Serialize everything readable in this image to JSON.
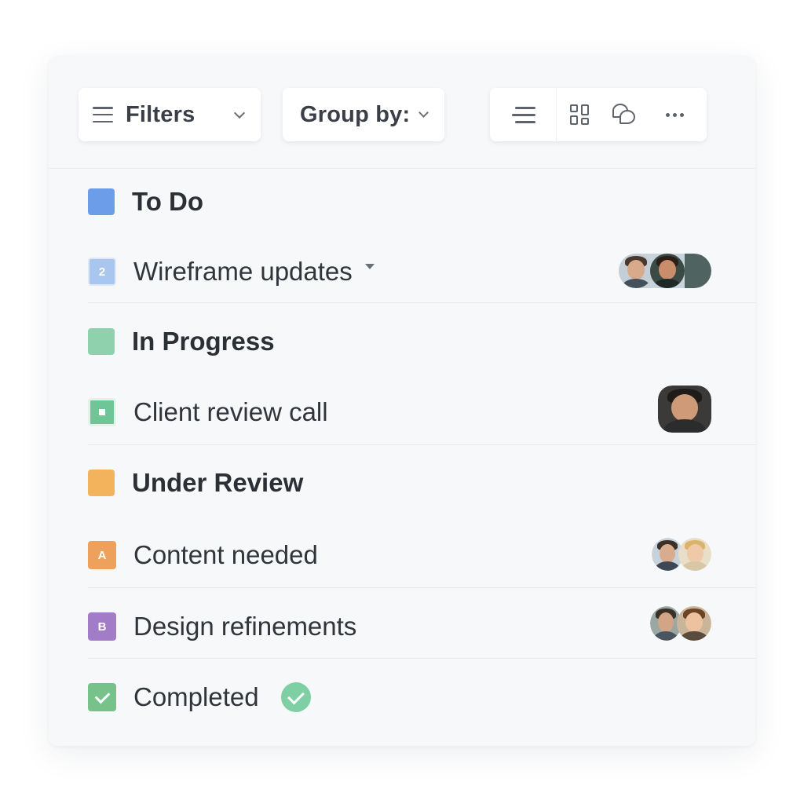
{
  "toolbar": {
    "filters_label": "Filters",
    "groupby_label": "Group by:",
    "views": [
      "list-view-icon",
      "board-view-icon",
      "chat-view-icon",
      "more-icon"
    ]
  },
  "groups": {
    "todo": {
      "title": "To Do",
      "color": "#6b9de8",
      "tasks": [
        {
          "title": "Wireframe updates",
          "badge": "2",
          "badge_color": "#a9c6ee",
          "assignees": 2
        }
      ]
    },
    "in_progress": {
      "title": "In Progress",
      "color": "#8fd1ac",
      "tasks": [
        {
          "title": "Client review call",
          "badge": "▪",
          "badge_color": "#6ec596",
          "assignees": 1
        }
      ]
    },
    "under_review": {
      "title": "Under Review",
      "color": "#f3b25c",
      "tasks": [
        {
          "title": "Content needed",
          "badge": "A",
          "badge_color": "#eea15c",
          "assignees": 2
        },
        {
          "title": "Design refinements",
          "badge": "B",
          "badge_color": "#a37cc8",
          "assignees": 2
        }
      ]
    },
    "completed": {
      "title": "Completed",
      "badge_color": "#77c28a"
    }
  }
}
